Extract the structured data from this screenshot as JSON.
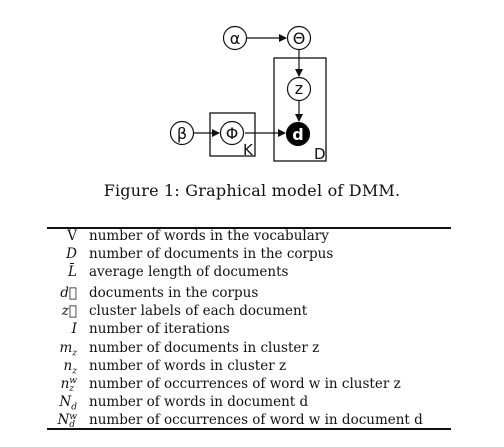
{
  "figure": {
    "nodes": {
      "alpha": "α",
      "theta": "Θ",
      "z": "z",
      "beta": "β",
      "phi": "Φ",
      "d": "d"
    },
    "plates": {
      "topics": "K",
      "documents": "D"
    },
    "observed_node_color": "#000000",
    "caption": "Figure 1: Graphical model of DMM."
  },
  "notation": {
    "rows": [
      {
        "symbol": "V",
        "description": "number of words in the vocabulary"
      },
      {
        "symbol": "D",
        "description": "number of documents in the corpus"
      },
      {
        "symbol": "L̄",
        "description": "average length of documents"
      },
      {
        "symbol": "d⃗",
        "description": "documents in the corpus"
      },
      {
        "symbol": "z⃗",
        "description": "cluster labels of each document"
      },
      {
        "symbol": "I",
        "description": "number of iterations"
      },
      {
        "symbol": "m_z",
        "description": "number of documents in cluster z"
      },
      {
        "symbol": "n_z",
        "description": "number of words in cluster z"
      },
      {
        "symbol": "n_z^w",
        "description": "number of occurrences of word w in cluster z"
      },
      {
        "symbol": "N_d",
        "description": "number of words in document d"
      },
      {
        "symbol": "N_d^w",
        "description": "number of occurrences of word w in document d"
      }
    ]
  }
}
